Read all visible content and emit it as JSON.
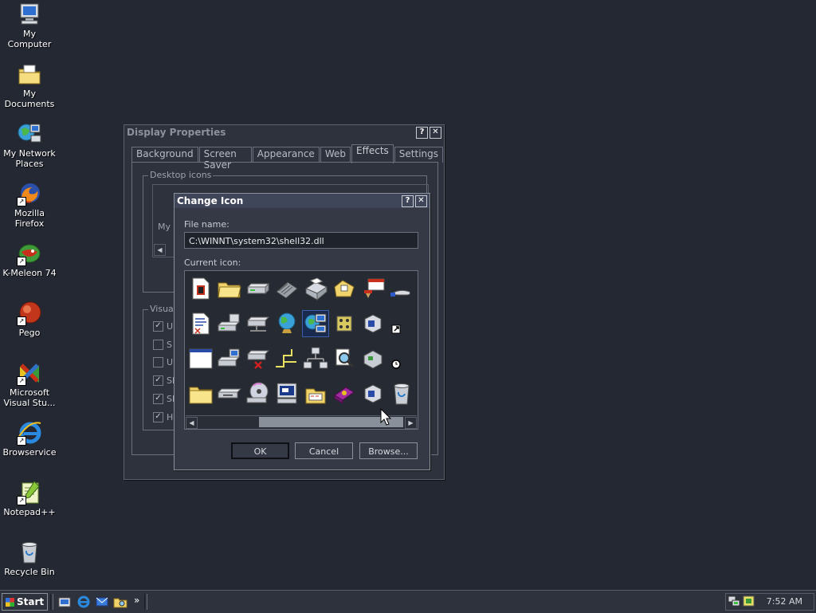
{
  "desktop": {
    "icons": [
      {
        "label": "My Computer",
        "icon": "computer-icon"
      },
      {
        "label": "My Documents",
        "icon": "documents-folder-icon"
      },
      {
        "label": "My Network Places",
        "icon": "network-places-icon"
      },
      {
        "label": "Mozilla Firefox",
        "icon": "firefox-icon"
      },
      {
        "label": "K-Meleon 74",
        "icon": "kmeleon-icon"
      },
      {
        "label": "Pego",
        "icon": "pego-icon"
      },
      {
        "label": "Microsoft Visual Stu...",
        "icon": "visual-studio-icon"
      },
      {
        "label": "Browservice",
        "icon": "internet-explorer-icon"
      },
      {
        "label": "Notepad++",
        "icon": "notepadpp-icon"
      },
      {
        "label": "Recycle Bin",
        "icon": "recycle-bin-icon"
      }
    ]
  },
  "display_properties": {
    "title": "Display Properties",
    "tabs": [
      "Background",
      "Screen Saver",
      "Appearance",
      "Web",
      "Effects",
      "Settings"
    ],
    "active_tab": "Effects",
    "desktop_icons_group": "Desktop icons",
    "desktop_icons_partial_label": "My C",
    "visual_group": "Visual",
    "visual_options": [
      {
        "text": "U",
        "checked": true
      },
      {
        "text": "S",
        "checked": false
      },
      {
        "text": "U",
        "checked": false
      },
      {
        "text": "Sh",
        "checked": true
      },
      {
        "text": "Sh",
        "checked": true
      },
      {
        "text": "H",
        "checked": true
      }
    ]
  },
  "change_icon": {
    "title": "Change Icon",
    "file_name_label": "File name:",
    "file_name_value": "C:\\WINNT\\system32\\shell32.dll",
    "current_icon_label": "Current icon:",
    "icons": [
      [
        "document-icon",
        "folder-open-icon",
        "drive-icon",
        "memory-chip-icon",
        "printer-icon",
        "folder-network-icon",
        "window-clock-icon",
        "hand-share-icon"
      ],
      [
        "text-document-icon",
        "computer-drive-icon",
        "network-drive-icon",
        "globe-icon",
        "network-computers-icon",
        "program-group-icon",
        "cube-icon",
        "shortcut-arrow-icon"
      ],
      [
        "application-window-icon",
        "computer-small-icon",
        "network-drive-disconnected-icon",
        "cable-icon",
        "network-tree-icon",
        "search-icon",
        "network-box-icon",
        "clock-overlay-icon"
      ],
      [
        "folder-icon",
        "floppy-drive-icon",
        "cd-drive-icon",
        "monitor-icon",
        "file-cabinet-icon",
        "book-icon",
        "cube-small-icon",
        "recycle-bin-icon"
      ]
    ],
    "buttons": {
      "ok": "OK",
      "cancel": "Cancel",
      "browse": "Browse..."
    }
  },
  "taskbar": {
    "start_label": "Start",
    "quick_launch": [
      "show-desktop-icon",
      "internet-explorer-icon",
      "outlook-icon",
      "explorer-icon"
    ],
    "chevron": "»",
    "clock": "7:52 AM"
  },
  "colors": {
    "desktop": "#242833",
    "window": "#2e323d",
    "dialog_title": "#40465a",
    "selection": "#1a2a4f"
  }
}
